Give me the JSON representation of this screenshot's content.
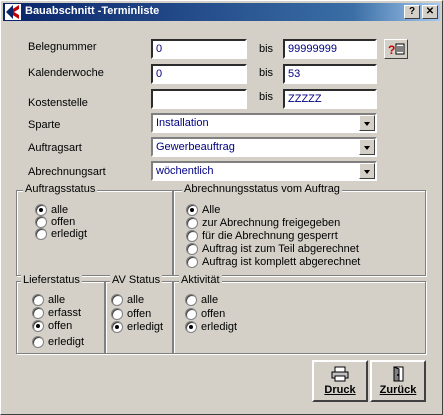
{
  "window": {
    "title": "Bauabschnitt -Terminliste",
    "help_btn": "?",
    "close_btn": "✕"
  },
  "filters": {
    "bis": "bis",
    "belegnummer": {
      "label": "Belegnummer",
      "from": "0",
      "to": "99999999"
    },
    "kalenderwoche": {
      "label": "Kalenderwoche",
      "from": "0",
      "to": "53"
    },
    "kostenstelle": {
      "label": "Kostenstelle",
      "from": "",
      "to": "ZZZZZ"
    },
    "sparte": {
      "label": "Sparte",
      "value": "Installation"
    },
    "auftragsart": {
      "label": "Auftragsart",
      "value": "Gewerbeauftrag"
    },
    "abrechnungsart": {
      "label": "Abrechnungsart",
      "value": "wöchentlich"
    }
  },
  "auftragsstatus": {
    "title": "Auftragsstatus",
    "options": [
      "alle",
      "offen",
      "erledigt"
    ],
    "selected": 0
  },
  "abrechnungsstatus": {
    "title": "Abrechnungsstatus vom Auftrag",
    "options": [
      "Alle",
      "zur Abrechnung freigegeben",
      "für die Abrechnung gesperrt",
      "Auftrag ist zum Teil abgerechnet",
      "Auftrag ist komplett abgerechnet"
    ],
    "selected": 0
  },
  "lieferstatus": {
    "title": "Lieferstatus",
    "options": [
      "alle",
      "erfasst",
      "offen",
      "erledigt"
    ],
    "selected": 2
  },
  "avstatus": {
    "title": "AV Status",
    "options": [
      "alle",
      "offen",
      "erledigt"
    ],
    "selected": 2
  },
  "aktivitaet": {
    "title": "Aktivität",
    "options": [
      "alle",
      "offen",
      "erledigt"
    ],
    "selected": 2
  },
  "buttons": {
    "druck": "Druck",
    "zurueck": "Zurück"
  }
}
